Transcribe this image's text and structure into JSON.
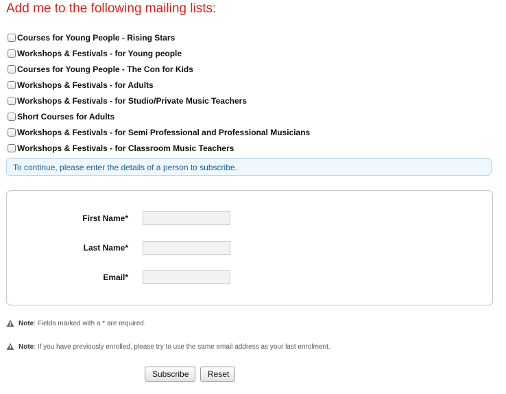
{
  "heading": "Add me to the following mailing lists:",
  "mailing_lists": [
    {
      "label": "Courses for Young People - Rising Stars",
      "checked": false
    },
    {
      "label": "Workshops & Festivals - for Young people",
      "checked": false
    },
    {
      "label": "Courses for Young People - The Con for Kids",
      "checked": false
    },
    {
      "label": "Workshops & Festivals - for Adults",
      "checked": false
    },
    {
      "label": "Workshops & Festivals - for Studio/Private Music Teachers",
      "checked": false
    },
    {
      "label": "Short Courses for Adults",
      "checked": false
    },
    {
      "label": "Workshops & Festivals - for Semi Professional and Professional Musicians",
      "checked": false
    },
    {
      "label": "Workshops & Festivals - for Classroom Music Teachers",
      "checked": false
    }
  ],
  "info_message": "To continue, please enter the details of a person to subscribe.",
  "form": {
    "first_name_label": "First Name*",
    "first_name_value": "",
    "last_name_label": "Last Name*",
    "last_name_value": "",
    "email_label": "Email*",
    "email_value": ""
  },
  "notes": [
    {
      "strong": "Note",
      "text": ": Fields marked with a * are required."
    },
    {
      "strong": "Note",
      "text": ": If you have previously enrolled, please try to use the same email address as your last enrolment."
    }
  ],
  "buttons": {
    "subscribe": "Subscribe",
    "reset": "Reset"
  },
  "colors": {
    "heading": "#d8221c",
    "info_background": "#eef7fd",
    "info_text": "#1e5e8a",
    "warning_icon": "#6b6b6b"
  },
  "icons": {
    "note_icon": "warning-triangle-icon"
  }
}
